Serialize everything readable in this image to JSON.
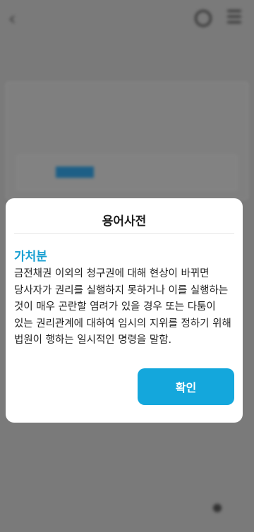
{
  "modal": {
    "title": "용어사전",
    "term": "가처분",
    "definition": "금전채권 이외의 청구권에 대해 현상이 바뀌면 당사자가 권리를 실행하지 못하거나 이를 실행하는 것이 매우 곤란할 염려가 있을 경우 또는 다툼이 있는 권리관계에 대하여 임시의 지위를 정하기 위해 법원이 행하는 일시적인 명령을 말함.",
    "confirm_label": "확인"
  },
  "colors": {
    "accent": "#14a7dc",
    "term_color": "#1aa0d2",
    "overlay": "#7a7a7a"
  },
  "icons": {
    "back": "back-chevron-icon",
    "notification": "bell-icon",
    "menu": "hamburger-menu-icon"
  }
}
